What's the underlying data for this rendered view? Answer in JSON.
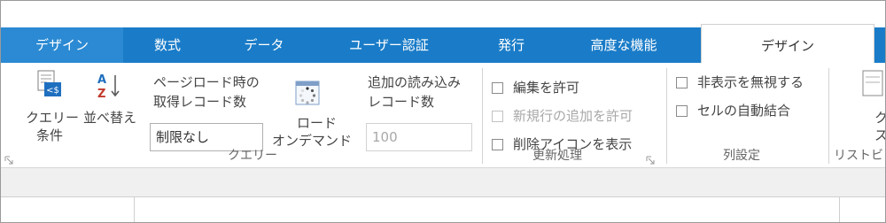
{
  "tabs": [
    {
      "label": "デザイン"
    },
    {
      "label": "数式"
    },
    {
      "label": "データ"
    },
    {
      "label": "ユーザー認証"
    },
    {
      "label": "発行"
    },
    {
      "label": "高度な機能"
    },
    {
      "label": "デザイン"
    }
  ],
  "query": {
    "condition_line1": "クエリー",
    "condition_line2": "条件",
    "sort": "並べ替え",
    "sort_icon_letters": "AZ",
    "page_load_line1": "ページロード時の",
    "page_load_line2": "取得レコード数",
    "page_load_value": "制限なし",
    "on_demand_line1": "ロード",
    "on_demand_line2": "オンデマンド",
    "add_load_line1": "追加の読み込み",
    "add_load_line2": "レコード数",
    "add_load_value": "100",
    "group_label": "クエリー"
  },
  "update": {
    "allow_edit": "編集を許可",
    "allow_add": "新規行の追加を許可",
    "show_delete": "削除アイコンを表示",
    "group_label": "更新処理"
  },
  "columns": {
    "ignore_hidden": "非表示を無視する",
    "auto_merge": "セルの自動結合",
    "group_label": "列設定"
  },
  "list": {
    "line1": "ク",
    "line2": "ス",
    "group_label": "リストビ"
  },
  "colors": {
    "tab_bar": "#1a7cc8",
    "tab_left": "#2b8ad3",
    "icon_blue": "#1f6fbf",
    "icon_red": "#c0392b"
  }
}
